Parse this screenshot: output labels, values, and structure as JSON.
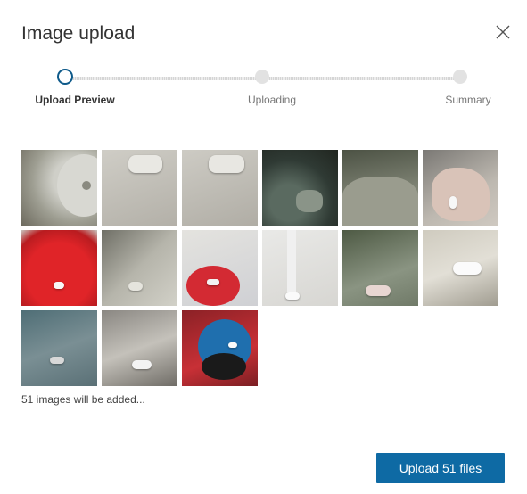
{
  "dialog": {
    "title": "Image upload",
    "close_icon": "close-icon"
  },
  "stepper": {
    "steps": [
      {
        "label": "Upload Preview",
        "state": "active"
      },
      {
        "label": "Uploading",
        "state": "pending"
      },
      {
        "label": "Summary",
        "state": "pending"
      }
    ]
  },
  "thumbnails": [
    {
      "name": "thumbnail-1"
    },
    {
      "name": "thumbnail-2"
    },
    {
      "name": "thumbnail-3"
    },
    {
      "name": "thumbnail-4"
    },
    {
      "name": "thumbnail-5"
    },
    {
      "name": "thumbnail-6"
    },
    {
      "name": "thumbnail-7"
    },
    {
      "name": "thumbnail-8"
    },
    {
      "name": "thumbnail-9"
    },
    {
      "name": "thumbnail-10"
    },
    {
      "name": "thumbnail-11"
    },
    {
      "name": "thumbnail-12"
    },
    {
      "name": "thumbnail-13"
    },
    {
      "name": "thumbnail-14"
    },
    {
      "name": "thumbnail-15"
    }
  ],
  "status": {
    "count_text": "51 images will be added..."
  },
  "footer": {
    "upload_label": "Upload 51 files"
  },
  "colors": {
    "primary_button": "#0e6aa4",
    "active_step": "#0e5a8a"
  }
}
